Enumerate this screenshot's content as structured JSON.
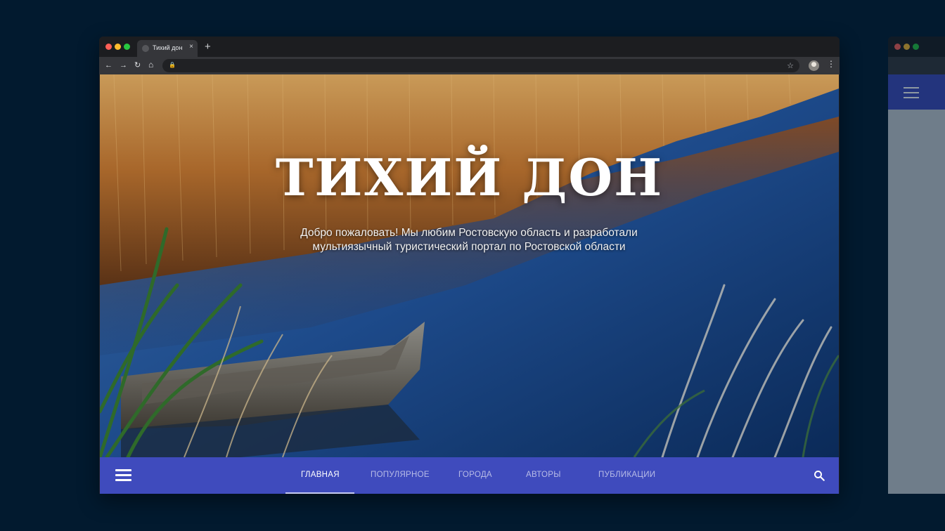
{
  "browser": {
    "tab_title": "Тихий дон",
    "close_glyph": "×",
    "new_tab_glyph": "+",
    "back_glyph": "←",
    "forward_glyph": "→",
    "reload_glyph": "↻",
    "home_glyph": "⌂",
    "lock_glyph": "🔒",
    "star_glyph": "☆",
    "menu_glyph": "⋮",
    "url": "",
    "traffic_lights": [
      "#ff5f57",
      "#febc2e",
      "#28c840"
    ]
  },
  "hero": {
    "title": "ТИХИЙ ДОН",
    "subtitle": "Добро пожаловать! Мы любим Ростовскую область и разработали мультиязычный туристический портал по Ростовской области"
  },
  "nav": {
    "items": [
      {
        "label": "ГЛАВНАЯ",
        "active": true
      },
      {
        "label": "ПОПУЛЯРНОЕ",
        "active": false
      },
      {
        "label": "ГОРОДА",
        "active": false
      },
      {
        "label": "АВТОРЫ",
        "active": false
      },
      {
        "label": "ПУБЛИКАЦИИ",
        "active": false
      }
    ],
    "menu_icon": "hamburger-icon",
    "search_icon": "search-icon"
  },
  "colors": {
    "background": "#021a2f",
    "nav_bar": "#3f4bbd",
    "active_link": "#ffffff"
  }
}
